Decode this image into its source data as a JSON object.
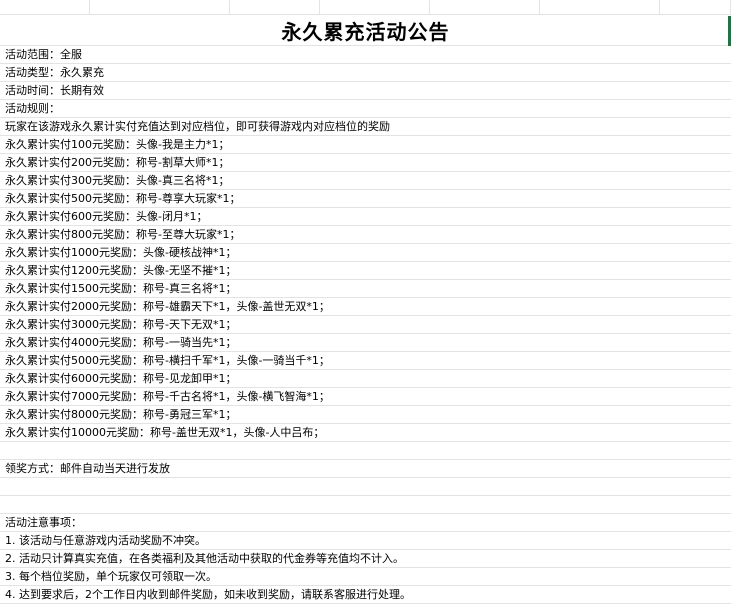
{
  "title": "永久累充活动公告",
  "info": {
    "scope": "活动范围：全服",
    "type": "活动类型：永久累充",
    "time": "活动时间：长期有效",
    "rules_heading": "活动规则："
  },
  "intro": "玩家在该游戏永久累计实付充值达到对应档位，即可获得游戏内对应档位的奖励",
  "tiers": [
    "永久累计实付100元奖励：头像-我是主力*1；",
    "永久累计实付200元奖励：称号-割草大师*1；",
    "永久累计实付300元奖励：头像-真三名将*1；",
    "永久累计实付500元奖励：称号-尊享大玩家*1；",
    "永久累计实付600元奖励：头像-闭月*1；",
    "永久累计实付800元奖励：称号-至尊大玩家*1；",
    "永久累计实付1000元奖励：头像-硬核战神*1；",
    "永久累计实付1200元奖励：头像-无坚不摧*1；",
    "永久累计实付1500元奖励：称号-真三名将*1；",
    "永久累计实付2000元奖励：称号-雄霸天下*1，头像-盖世无双*1；",
    "永久累计实付3000元奖励：称号-天下无双*1；",
    "永久累计实付4000元奖励：称号-一骑当先*1；",
    "永久累计实付5000元奖励：称号-横扫千军*1，头像-一骑当千*1；",
    "永久累计实付6000元奖励：称号-见龙卸甲*1；",
    "永久累计实付7000元奖励：称号-千古名将*1，头像-横飞智海*1；",
    "永久累计实付8000元奖励：称号-勇冠三军*1；",
    "永久累计实付10000元奖励：称号-盖世无双*1，头像-人中吕布；"
  ],
  "claim": "领奖方式：邮件自动当天进行发放",
  "notes_heading": "活动注意事项：",
  "notes": [
    "1. 该活动与任意游戏内活动奖励不冲突。",
    "2. 活动只计算真实充值，在各类福利及其他活动中获取的代金券等充值均不计入。",
    "3. 每个档位奖励，单个玩家仅可领取一次。",
    "4. 达到要求后，2个工作日内收到邮件奖励，如未收到奖励，请联系客服进行处理。"
  ],
  "accent_color": "#217346"
}
